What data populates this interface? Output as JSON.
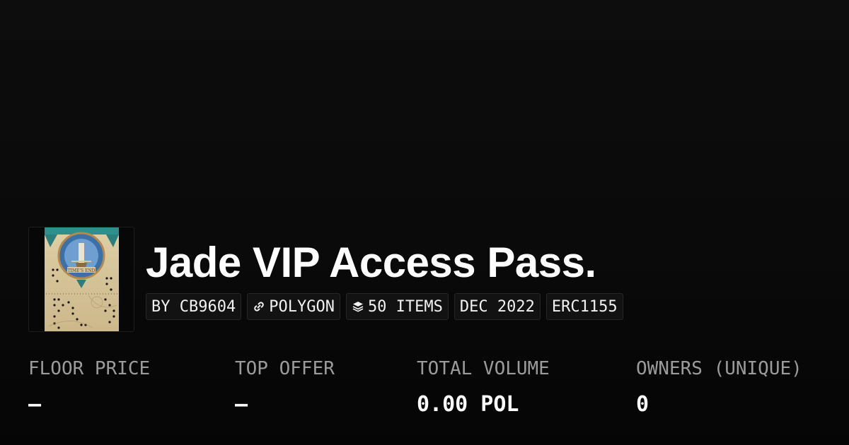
{
  "collection": {
    "title": "Jade VIP Access Pass.",
    "thumbnail_icon": "collection-thumbnail"
  },
  "badges": [
    {
      "label": "BY CB9604"
    },
    {
      "label": "POLYGON",
      "icon": "chain-link-icon"
    },
    {
      "label": "50 ITEMS",
      "icon": "layers-icon"
    },
    {
      "label": "DEC 2022"
    },
    {
      "label": "ERC1155"
    }
  ],
  "stats": [
    {
      "label": "FLOOR PRICE",
      "value": "–"
    },
    {
      "label": "TOP OFFER",
      "value": "–"
    },
    {
      "label": "TOTAL VOLUME",
      "value": "0.00 POL"
    },
    {
      "label": "OWNERS (UNIQUE)",
      "value": "0"
    }
  ],
  "colors": {
    "background": "#0a0a0a",
    "badge_background": "#121212",
    "label_gray": "#9b9b9b",
    "text": "#ffffff"
  }
}
